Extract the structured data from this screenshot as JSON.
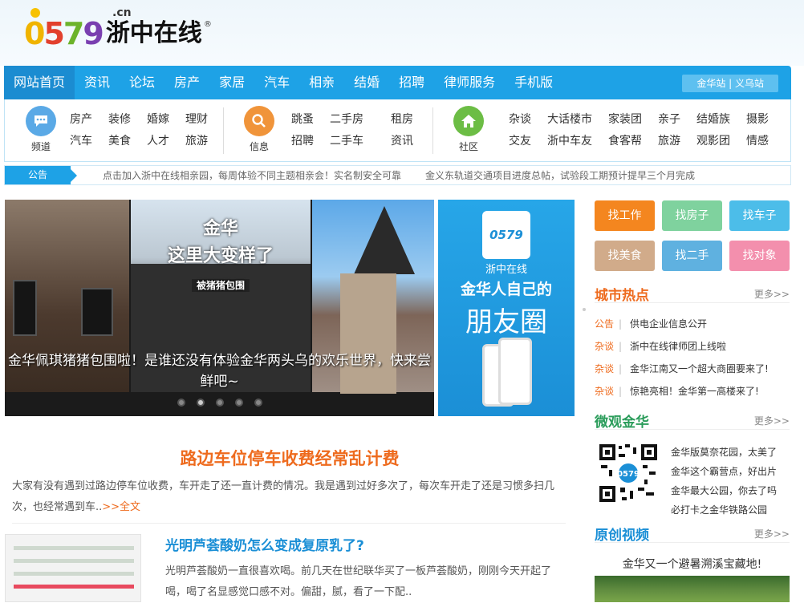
{
  "logo": {
    "digits": [
      "0",
      "5",
      "7",
      "9"
    ],
    "tld": ".cn",
    "name": "浙中在线",
    "reg": "®"
  },
  "nav": {
    "items": [
      "网站首页",
      "资讯",
      "论坛",
      "房产",
      "家居",
      "汽车",
      "相亲",
      "结婚",
      "招聘",
      "律师服务",
      "手机版"
    ],
    "active_index": 0,
    "sites": "金华站 | 义乌站"
  },
  "subnav": {
    "groups": [
      {
        "label": "频道",
        "icon": "chat-bubble-icon",
        "color": "#5aa9e6",
        "links": [
          "房产",
          "装修",
          "婚嫁",
          "理财",
          "汽车",
          "美食",
          "人才",
          "旅游"
        ]
      },
      {
        "label": "信息",
        "icon": "search-icon",
        "color": "#f0943a",
        "links": [
          "跳蚤",
          "二手房",
          "租房",
          "招聘",
          "二手车",
          "资讯"
        ]
      },
      {
        "label": "社区",
        "icon": "home-icon",
        "color": "#6cbd45",
        "links": [
          "杂谈",
          "大话楼市",
          "家装团",
          "亲子",
          "结婚族",
          "摄影",
          "交友",
          "浙中车友",
          "食客帮",
          "旅游",
          "观影团",
          "情感"
        ]
      }
    ]
  },
  "notice": {
    "label": "公告",
    "items": [
      "点击加入浙中在线相亲园，每周体验不同主题相亲会！实名制安全可靠",
      "金义东轨道交通项目进度总帖，试验段工期预计提早三个月完成"
    ]
  },
  "slider": {
    "photo_title": "金华\n这里大变样了",
    "photo_subtitle": "被猪猪包围",
    "caption": "金华佩琪猪猪包围啦！是谁还没有体验金华两头乌的欢乐世界，快来尝鲜吧~",
    "dots": 5,
    "active_dot": 1
  },
  "promo": {
    "logo": "0579",
    "line1": "浙中在线",
    "line2": "金华人自己的",
    "line3": "朋友圈"
  },
  "headline": {
    "title": "路边车位停车收费经常乱计费",
    "summary": "大家有没有遇到过路边停车位收费，车开走了还一直计费的情况。我是遇到过好多次了，每次车开走了还是习惯多扫几次，也经常遇到车..",
    "more": ">>全文"
  },
  "article2": {
    "title": "光明芦荟酸奶怎么变成复原乳了?",
    "summary": "光明芦荟酸奶一直很喜欢喝。前几天在世纪联华买了一板芦荟酸奶，刚刚今天开起了喝，喝了名显感觉口感不对。偏甜，腻，看了一下配.."
  },
  "quick_buttons": [
    {
      "label": "找工作",
      "color": "#f4861f"
    },
    {
      "label": "找房子",
      "color": "#7fd29e"
    },
    {
      "label": "找车子",
      "color": "#4cbde9"
    },
    {
      "label": "找美食",
      "color": "#d1ab8a"
    },
    {
      "label": "找二手",
      "color": "#5fb1e0"
    },
    {
      "label": "找对象",
      "color": "#f38fad"
    }
  ],
  "city_hot": {
    "title": "城市热点",
    "more": "更多>>",
    "items": [
      {
        "kind": "公告",
        "text": "供电企业信息公开"
      },
      {
        "kind": "杂谈",
        "text": "浙中在线律师团上线啦"
      },
      {
        "kind": "杂谈",
        "text": "金华江南又一个超大商圈要来了!"
      },
      {
        "kind": "杂谈",
        "text": "惊艳亮相！金华第一高楼来了!"
      }
    ]
  },
  "micro": {
    "title": "微观金华",
    "more": "更多>>",
    "qr_label": "0579",
    "lines": [
      "金华版莫奈花园，太美了",
      "金华这个霸营点，好出片",
      "金华最大公园，你去了吗",
      "必打卡之金华铁路公园"
    ]
  },
  "video": {
    "title": "原创视频",
    "more": "更多>>",
    "caption": "金华又一个避暑溯溪宝藏地!"
  },
  "colors": {
    "nav_blue": "#1ea2e6",
    "accent_orange": "#ee6b1e",
    "section_orange": "#ee6b1e",
    "micro_green": "#2a9c5a",
    "video_blue": "#1b8fd6"
  }
}
